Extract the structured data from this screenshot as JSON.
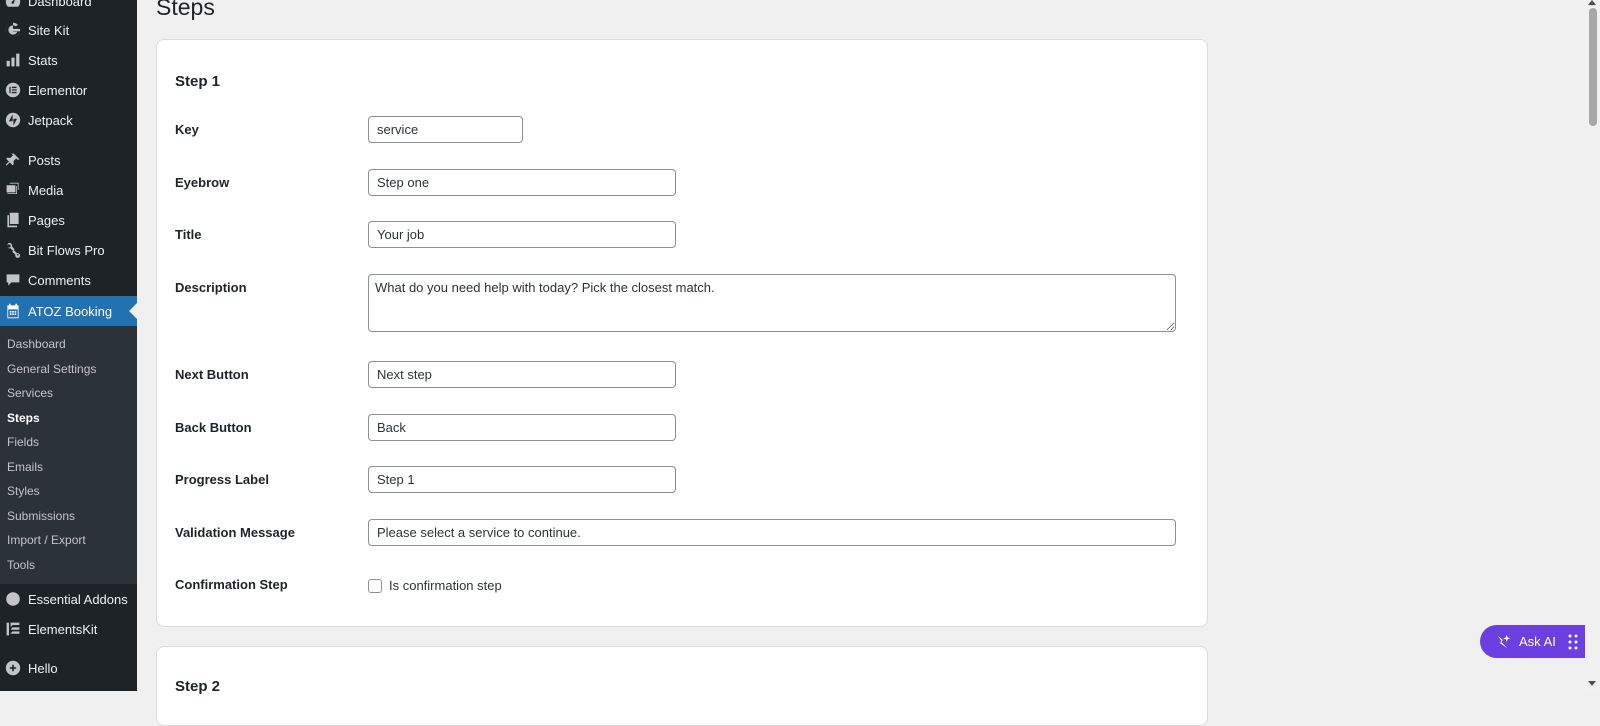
{
  "sidebar": {
    "menu": [
      {
        "label": "Dashboard",
        "icon": "dashboard-icon"
      },
      {
        "label": "Site Kit",
        "icon": "google-g-icon"
      },
      {
        "label": "Stats",
        "icon": "bar-chart-icon"
      },
      {
        "label": "Elementor",
        "icon": "elementor-icon"
      },
      {
        "label": "Jetpack",
        "icon": "jetpack-bolt-icon"
      },
      {
        "label": "Posts",
        "icon": "pushpin-icon"
      },
      {
        "label": "Media",
        "icon": "media-icon"
      },
      {
        "label": "Pages",
        "icon": "pages-icon"
      },
      {
        "label": "Bit Flows Pro",
        "icon": "flow-icon"
      },
      {
        "label": "Comments",
        "icon": "comment-icon"
      },
      {
        "label": "ATOZ Booking",
        "icon": "calendar-icon"
      },
      {
        "label": "Essential Addons",
        "icon": "ea-icon"
      },
      {
        "label": "ElementsKit",
        "icon": "elementskit-icon"
      },
      {
        "label": "Hello",
        "icon": "plus-circle-icon"
      }
    ],
    "submenu": [
      "Dashboard",
      "General Settings",
      "Services",
      "Steps",
      "Fields",
      "Emails",
      "Styles",
      "Submissions",
      "Import / Export",
      "Tools"
    ],
    "current_submenu": "Steps"
  },
  "page": {
    "title": "Steps"
  },
  "step1": {
    "heading": "Step 1",
    "labels": {
      "key": "Key",
      "eyebrow": "Eyebrow",
      "title": "Title",
      "description": "Description",
      "next_button": "Next Button",
      "back_button": "Back Button",
      "progress_label": "Progress Label",
      "validation_message": "Validation Message",
      "confirmation_step": "Confirmation Step"
    },
    "values": {
      "key": "service",
      "eyebrow": "Step one",
      "title": "Your job",
      "description": "What do you need help with today? Pick the closest match.",
      "next_button": "Next step",
      "back_button": "Back",
      "progress_label": "Step 1",
      "validation_message": "Please select a service to continue."
    },
    "confirmation_checkbox_label": "Is confirmation step",
    "confirmation_checked": false
  },
  "step2": {
    "heading": "Step 2"
  },
  "ask_ai": {
    "label": "Ask AI"
  },
  "colors": {
    "sidebar_bg": "#1d2327",
    "submenu_bg": "#2c3338",
    "accent": "#2271b1",
    "ask_ai": "#6c3fe0"
  }
}
